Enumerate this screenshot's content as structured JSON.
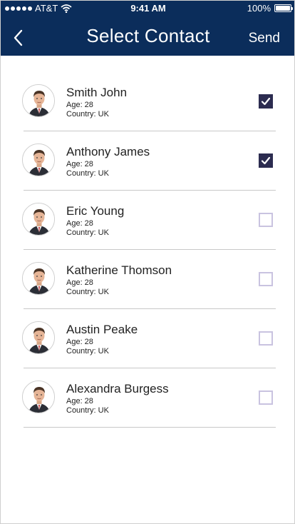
{
  "status_bar": {
    "carrier": "AT&T",
    "time": "9:41 AM",
    "battery_level": "100%",
    "battery_fraction": 1.0
  },
  "header": {
    "title": "Select Contact",
    "send_label": "Send",
    "back_icon": "chevron-left-icon"
  },
  "colors": {
    "header_bg": "#0b2d5b",
    "checkbox_checked": "#2c2c50",
    "checkbox_unchecked_border": "#c9c3e0"
  },
  "contacts": [
    {
      "name": "Smith John",
      "age": "Age: 28",
      "country": "Country: UK",
      "selected": true
    },
    {
      "name": "Anthony James",
      "age": "Age: 28",
      "country": "Country: UK",
      "selected": true
    },
    {
      "name": "Eric Young",
      "age": "Age: 28",
      "country": "Country: UK",
      "selected": false
    },
    {
      "name": "Katherine Thomson",
      "age": "Age: 28",
      "country": "Country: UK",
      "selected": false
    },
    {
      "name": "Austin Peake",
      "age": "Age: 28",
      "country": "Country: UK",
      "selected": false
    },
    {
      "name": "Alexandra Burgess",
      "age": "Age: 28",
      "country": "Country: UK",
      "selected": false
    }
  ]
}
